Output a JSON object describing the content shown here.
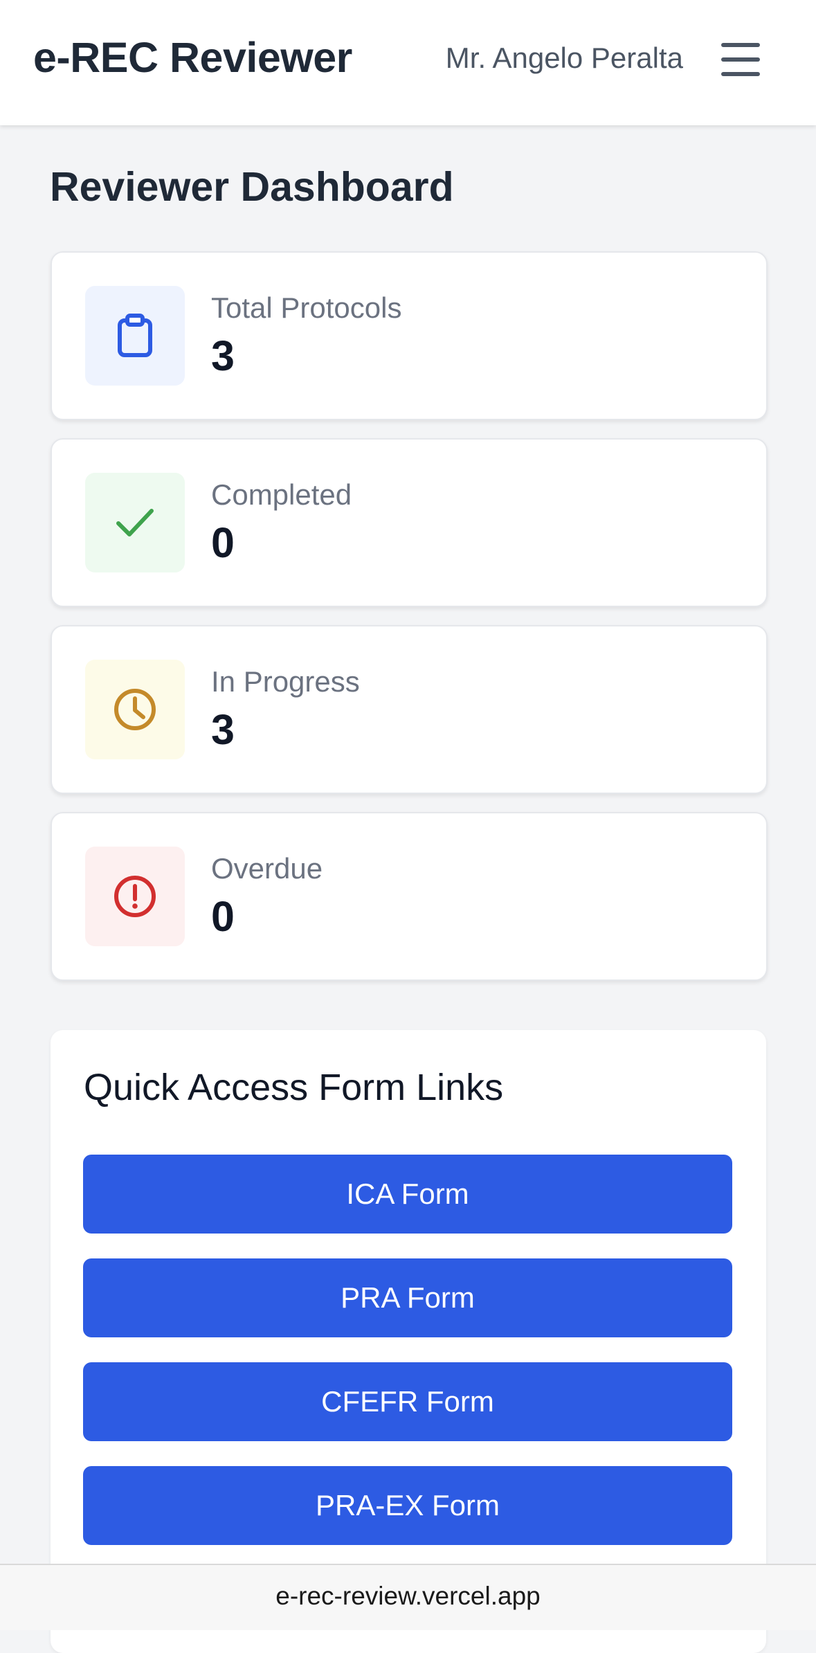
{
  "header": {
    "app_title": "e-REC Reviewer",
    "user_name": "Mr. Angelo Peralta",
    "menu_icon": "hamburger-menu-icon"
  },
  "page": {
    "title": "Reviewer Dashboard"
  },
  "stats": [
    {
      "label": "Total Protocols",
      "value": "3",
      "icon": "clipboard-icon",
      "icon_color": "#2d5be3",
      "icon_bg": "#eef3fe"
    },
    {
      "label": "Completed",
      "value": "0",
      "icon": "checkmark-icon",
      "icon_color": "#3fa34d",
      "icon_bg": "#eefaf0"
    },
    {
      "label": "In Progress",
      "value": "3",
      "icon": "clock-icon",
      "icon_color": "#c48a2a",
      "icon_bg": "#fdfbe8"
    },
    {
      "label": "Overdue",
      "value": "0",
      "icon": "alert-circle-icon",
      "icon_color": "#d22f2f",
      "icon_bg": "#fdf0f0"
    }
  ],
  "quick_access": {
    "title": "Quick Access Form Links",
    "buttons": [
      "ICA Form",
      "PRA Form",
      "CFEFR Form",
      "PRA-EX Form"
    ],
    "button_color": "#2d5be3"
  },
  "browser": {
    "url": "e-rec-review.vercel.app"
  }
}
